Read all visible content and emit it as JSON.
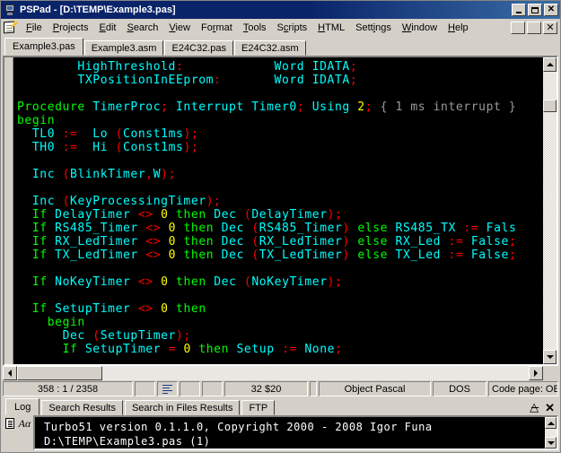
{
  "window": {
    "title": "PSPad - [D:\\TEMP\\Example3.pas]",
    "icon": "pspad-icon",
    "buttons": {
      "minimize": "_",
      "maximize": "□",
      "close": "×"
    }
  },
  "menu": {
    "icon": "notepad-pencil-icon",
    "items": [
      {
        "label": "File",
        "accel": "F"
      },
      {
        "label": "Projects",
        "accel": "P"
      },
      {
        "label": "Edit",
        "accel": "E"
      },
      {
        "label": "Search",
        "accel": "S"
      },
      {
        "label": "View",
        "accel": "V"
      },
      {
        "label": "Format",
        "accel": "r"
      },
      {
        "label": "Tools",
        "accel": "T"
      },
      {
        "label": "Scripts",
        "accel": "c"
      },
      {
        "label": "HTML",
        "accel": "H"
      },
      {
        "label": "Settings",
        "accel": "i"
      },
      {
        "label": "Window",
        "accel": "W"
      },
      {
        "label": "Help",
        "accel": "H"
      }
    ],
    "mdi_buttons": {
      "minimize": "_",
      "restore": "❐",
      "close": "×"
    }
  },
  "editor_tabs": [
    {
      "label": "Example3.pas",
      "active": true
    },
    {
      "label": "Example3.asm",
      "active": false
    },
    {
      "label": "E24C32.pas",
      "active": false
    },
    {
      "label": "E24C32.asm",
      "active": false
    }
  ],
  "code": {
    "language": "Object Pascal",
    "lines": [
      [
        {
          "t": "        ",
          "c": "i"
        },
        {
          "t": "HighThreshold",
          "c": "i"
        },
        {
          "t": ":",
          "c": "p"
        },
        {
          "t": "            ",
          "c": "i"
        },
        {
          "t": "Word",
          "c": "i"
        },
        {
          "t": " ",
          "c": "i"
        },
        {
          "t": "IDATA",
          "c": "i"
        },
        {
          "t": ";",
          "c": "p"
        }
      ],
      [
        {
          "t": "        ",
          "c": "i"
        },
        {
          "t": "TXPositionInEEprom",
          "c": "i"
        },
        {
          "t": ":",
          "c": "p"
        },
        {
          "t": "       ",
          "c": "i"
        },
        {
          "t": "Word",
          "c": "i"
        },
        {
          "t": " ",
          "c": "i"
        },
        {
          "t": "IDATA",
          "c": "i"
        },
        {
          "t": ";",
          "c": "p"
        }
      ],
      [
        {
          "t": "",
          "c": "i"
        }
      ],
      [
        {
          "t": "Procedure",
          "c": "k"
        },
        {
          "t": " ",
          "c": "i"
        },
        {
          "t": "TimerProc",
          "c": "i"
        },
        {
          "t": ";",
          "c": "p"
        },
        {
          "t": " ",
          "c": "i"
        },
        {
          "t": "Interrupt",
          "c": "i"
        },
        {
          "t": " ",
          "c": "i"
        },
        {
          "t": "Timer0",
          "c": "i"
        },
        {
          "t": ";",
          "c": "p"
        },
        {
          "t": " ",
          "c": "i"
        },
        {
          "t": "Using",
          "c": "i"
        },
        {
          "t": " ",
          "c": "i"
        },
        {
          "t": "2",
          "c": "n"
        },
        {
          "t": ";",
          "c": "p"
        },
        {
          "t": " ",
          "c": "i"
        },
        {
          "t": "{ 1 ms interrupt }",
          "c": "c"
        }
      ],
      [
        {
          "t": "begin",
          "c": "k"
        }
      ],
      [
        {
          "t": "  ",
          "c": "i"
        },
        {
          "t": "TL0",
          "c": "i"
        },
        {
          "t": " ",
          "c": "i"
        },
        {
          "t": ":=",
          "c": "p"
        },
        {
          "t": "  ",
          "c": "i"
        },
        {
          "t": "Lo",
          "c": "i"
        },
        {
          "t": " ",
          "c": "i"
        },
        {
          "t": "(",
          "c": "p"
        },
        {
          "t": "Const1ms",
          "c": "i"
        },
        {
          "t": ");",
          "c": "p"
        }
      ],
      [
        {
          "t": "  ",
          "c": "i"
        },
        {
          "t": "TH0",
          "c": "i"
        },
        {
          "t": " ",
          "c": "i"
        },
        {
          "t": ":=",
          "c": "p"
        },
        {
          "t": "  ",
          "c": "i"
        },
        {
          "t": "Hi",
          "c": "i"
        },
        {
          "t": " ",
          "c": "i"
        },
        {
          "t": "(",
          "c": "p"
        },
        {
          "t": "Const1ms",
          "c": "i"
        },
        {
          "t": ");",
          "c": "p"
        }
      ],
      [
        {
          "t": "",
          "c": "i"
        }
      ],
      [
        {
          "t": "  ",
          "c": "i"
        },
        {
          "t": "Inc",
          "c": "i"
        },
        {
          "t": " ",
          "c": "i"
        },
        {
          "t": "(",
          "c": "p"
        },
        {
          "t": "BlinkTimer",
          "c": "i"
        },
        {
          "t": ",",
          "c": "p"
        },
        {
          "t": "W",
          "c": "i"
        },
        {
          "t": ");",
          "c": "p"
        }
      ],
      [
        {
          "t": "",
          "c": "i"
        }
      ],
      [
        {
          "t": "  ",
          "c": "i"
        },
        {
          "t": "Inc",
          "c": "i"
        },
        {
          "t": " ",
          "c": "i"
        },
        {
          "t": "(",
          "c": "p"
        },
        {
          "t": "KeyProcessingTimer",
          "c": "i"
        },
        {
          "t": ");",
          "c": "p"
        }
      ],
      [
        {
          "t": "  ",
          "c": "i"
        },
        {
          "t": "If",
          "c": "k"
        },
        {
          "t": " ",
          "c": "i"
        },
        {
          "t": "DelayTimer",
          "c": "i"
        },
        {
          "t": " ",
          "c": "i"
        },
        {
          "t": "<>",
          "c": "p"
        },
        {
          "t": " ",
          "c": "i"
        },
        {
          "t": "0",
          "c": "n"
        },
        {
          "t": " ",
          "c": "i"
        },
        {
          "t": "then",
          "c": "k"
        },
        {
          "t": " ",
          "c": "i"
        },
        {
          "t": "Dec",
          "c": "i"
        },
        {
          "t": " ",
          "c": "i"
        },
        {
          "t": "(",
          "c": "p"
        },
        {
          "t": "DelayTimer",
          "c": "i"
        },
        {
          "t": ");",
          "c": "p"
        }
      ],
      [
        {
          "t": "  ",
          "c": "i"
        },
        {
          "t": "If",
          "c": "k"
        },
        {
          "t": " ",
          "c": "i"
        },
        {
          "t": "RS485_Timer",
          "c": "i"
        },
        {
          "t": " ",
          "c": "i"
        },
        {
          "t": "<>",
          "c": "p"
        },
        {
          "t": " ",
          "c": "i"
        },
        {
          "t": "0",
          "c": "n"
        },
        {
          "t": " ",
          "c": "i"
        },
        {
          "t": "then",
          "c": "k"
        },
        {
          "t": " ",
          "c": "i"
        },
        {
          "t": "Dec",
          "c": "i"
        },
        {
          "t": " ",
          "c": "i"
        },
        {
          "t": "(",
          "c": "p"
        },
        {
          "t": "RS485_Timer",
          "c": "i"
        },
        {
          "t": ")",
          "c": "p"
        },
        {
          "t": " ",
          "c": "i"
        },
        {
          "t": "else",
          "c": "k"
        },
        {
          "t": " ",
          "c": "i"
        },
        {
          "t": "RS485_TX",
          "c": "i"
        },
        {
          "t": " ",
          "c": "i"
        },
        {
          "t": ":=",
          "c": "p"
        },
        {
          "t": " ",
          "c": "i"
        },
        {
          "t": "Fals",
          "c": "i"
        }
      ],
      [
        {
          "t": "  ",
          "c": "i"
        },
        {
          "t": "If",
          "c": "k"
        },
        {
          "t": " ",
          "c": "i"
        },
        {
          "t": "RX_LedTimer",
          "c": "i"
        },
        {
          "t": " ",
          "c": "i"
        },
        {
          "t": "<>",
          "c": "p"
        },
        {
          "t": " ",
          "c": "i"
        },
        {
          "t": "0",
          "c": "n"
        },
        {
          "t": " ",
          "c": "i"
        },
        {
          "t": "then",
          "c": "k"
        },
        {
          "t": " ",
          "c": "i"
        },
        {
          "t": "Dec",
          "c": "i"
        },
        {
          "t": " ",
          "c": "i"
        },
        {
          "t": "(",
          "c": "p"
        },
        {
          "t": "RX_LedTimer",
          "c": "i"
        },
        {
          "t": ")",
          "c": "p"
        },
        {
          "t": " ",
          "c": "i"
        },
        {
          "t": "else",
          "c": "k"
        },
        {
          "t": " ",
          "c": "i"
        },
        {
          "t": "RX_Led",
          "c": "i"
        },
        {
          "t": " ",
          "c": "i"
        },
        {
          "t": ":=",
          "c": "p"
        },
        {
          "t": " ",
          "c": "i"
        },
        {
          "t": "False",
          "c": "i"
        },
        {
          "t": ";",
          "c": "p"
        }
      ],
      [
        {
          "t": "  ",
          "c": "i"
        },
        {
          "t": "If",
          "c": "k"
        },
        {
          "t": " ",
          "c": "i"
        },
        {
          "t": "TX_LedTimer",
          "c": "i"
        },
        {
          "t": " ",
          "c": "i"
        },
        {
          "t": "<>",
          "c": "p"
        },
        {
          "t": " ",
          "c": "i"
        },
        {
          "t": "0",
          "c": "n"
        },
        {
          "t": " ",
          "c": "i"
        },
        {
          "t": "then",
          "c": "k"
        },
        {
          "t": " ",
          "c": "i"
        },
        {
          "t": "Dec",
          "c": "i"
        },
        {
          "t": " ",
          "c": "i"
        },
        {
          "t": "(",
          "c": "p"
        },
        {
          "t": "TX_LedTimer",
          "c": "i"
        },
        {
          "t": ")",
          "c": "p"
        },
        {
          "t": " ",
          "c": "i"
        },
        {
          "t": "else",
          "c": "k"
        },
        {
          "t": " ",
          "c": "i"
        },
        {
          "t": "TX_Led",
          "c": "i"
        },
        {
          "t": " ",
          "c": "i"
        },
        {
          "t": ":=",
          "c": "p"
        },
        {
          "t": " ",
          "c": "i"
        },
        {
          "t": "False",
          "c": "i"
        },
        {
          "t": ";",
          "c": "p"
        }
      ],
      [
        {
          "t": "",
          "c": "i"
        }
      ],
      [
        {
          "t": "  ",
          "c": "i"
        },
        {
          "t": "If",
          "c": "k"
        },
        {
          "t": " ",
          "c": "i"
        },
        {
          "t": "NoKeyTimer",
          "c": "i"
        },
        {
          "t": " ",
          "c": "i"
        },
        {
          "t": "<>",
          "c": "p"
        },
        {
          "t": " ",
          "c": "i"
        },
        {
          "t": "0",
          "c": "n"
        },
        {
          "t": " ",
          "c": "i"
        },
        {
          "t": "then",
          "c": "k"
        },
        {
          "t": " ",
          "c": "i"
        },
        {
          "t": "Dec",
          "c": "i"
        },
        {
          "t": " ",
          "c": "i"
        },
        {
          "t": "(",
          "c": "p"
        },
        {
          "t": "NoKeyTimer",
          "c": "i"
        },
        {
          "t": ");",
          "c": "p"
        }
      ],
      [
        {
          "t": "",
          "c": "i"
        }
      ],
      [
        {
          "t": "  ",
          "c": "i"
        },
        {
          "t": "If",
          "c": "k"
        },
        {
          "t": " ",
          "c": "i"
        },
        {
          "t": "SetupTimer",
          "c": "i"
        },
        {
          "t": " ",
          "c": "i"
        },
        {
          "t": "<>",
          "c": "p"
        },
        {
          "t": " ",
          "c": "i"
        },
        {
          "t": "0",
          "c": "n"
        },
        {
          "t": " ",
          "c": "i"
        },
        {
          "t": "then",
          "c": "k"
        }
      ],
      [
        {
          "t": "    ",
          "c": "i"
        },
        {
          "t": "begin",
          "c": "k"
        }
      ],
      [
        {
          "t": "      ",
          "c": "i"
        },
        {
          "t": "Dec",
          "c": "i"
        },
        {
          "t": " ",
          "c": "i"
        },
        {
          "t": "(",
          "c": "p"
        },
        {
          "t": "SetupTimer",
          "c": "i"
        },
        {
          "t": ");",
          "c": "p"
        }
      ],
      [
        {
          "t": "      ",
          "c": "i"
        },
        {
          "t": "If",
          "c": "k"
        },
        {
          "t": " ",
          "c": "i"
        },
        {
          "t": "SetupTimer",
          "c": "i"
        },
        {
          "t": " ",
          "c": "i"
        },
        {
          "t": "=",
          "c": "p"
        },
        {
          "t": " ",
          "c": "i"
        },
        {
          "t": "0",
          "c": "n"
        },
        {
          "t": " ",
          "c": "i"
        },
        {
          "t": "then",
          "c": "k"
        },
        {
          "t": " ",
          "c": "i"
        },
        {
          "t": "Setup",
          "c": "i"
        },
        {
          "t": " ",
          "c": "i"
        },
        {
          "t": ":=",
          "c": "p"
        },
        {
          "t": " ",
          "c": "i"
        },
        {
          "t": "None",
          "c": "i"
        },
        {
          "t": ";",
          "c": "p"
        }
      ]
    ]
  },
  "statusbar": {
    "position": "358 : 1 / 2358",
    "lines_icon": "lines-indicator",
    "char_code": "32  $20",
    "syntax": "Object Pascal",
    "line_ending": "DOS",
    "code_page": "Code page: OEM (D"
  },
  "panel": {
    "tabs": [
      {
        "label": "Log",
        "active": true
      },
      {
        "label": "Search Results",
        "active": false
      },
      {
        "label": "Search in Files Results",
        "active": false
      },
      {
        "label": "FTP",
        "active": false
      }
    ],
    "controls": {
      "collapse": "«",
      "close": "✕"
    },
    "side_icons": [
      "document-icon",
      "font-icon"
    ],
    "log_lines": [
      "Turbo51 version 0.1.1.0, Copyright 2000 - 2008 Igor Funa",
      "D:\\TEMP\\Example3.pas (1)"
    ]
  },
  "colors": {
    "titlebar": "#0a246a",
    "face": "#d4d0c8",
    "editor_bg": "#000000",
    "keyword": "#00ff00",
    "identifier": "#00ffff",
    "punctuation": "#ff0000",
    "number": "#ffff00",
    "comment": "#9a9a9a"
  }
}
